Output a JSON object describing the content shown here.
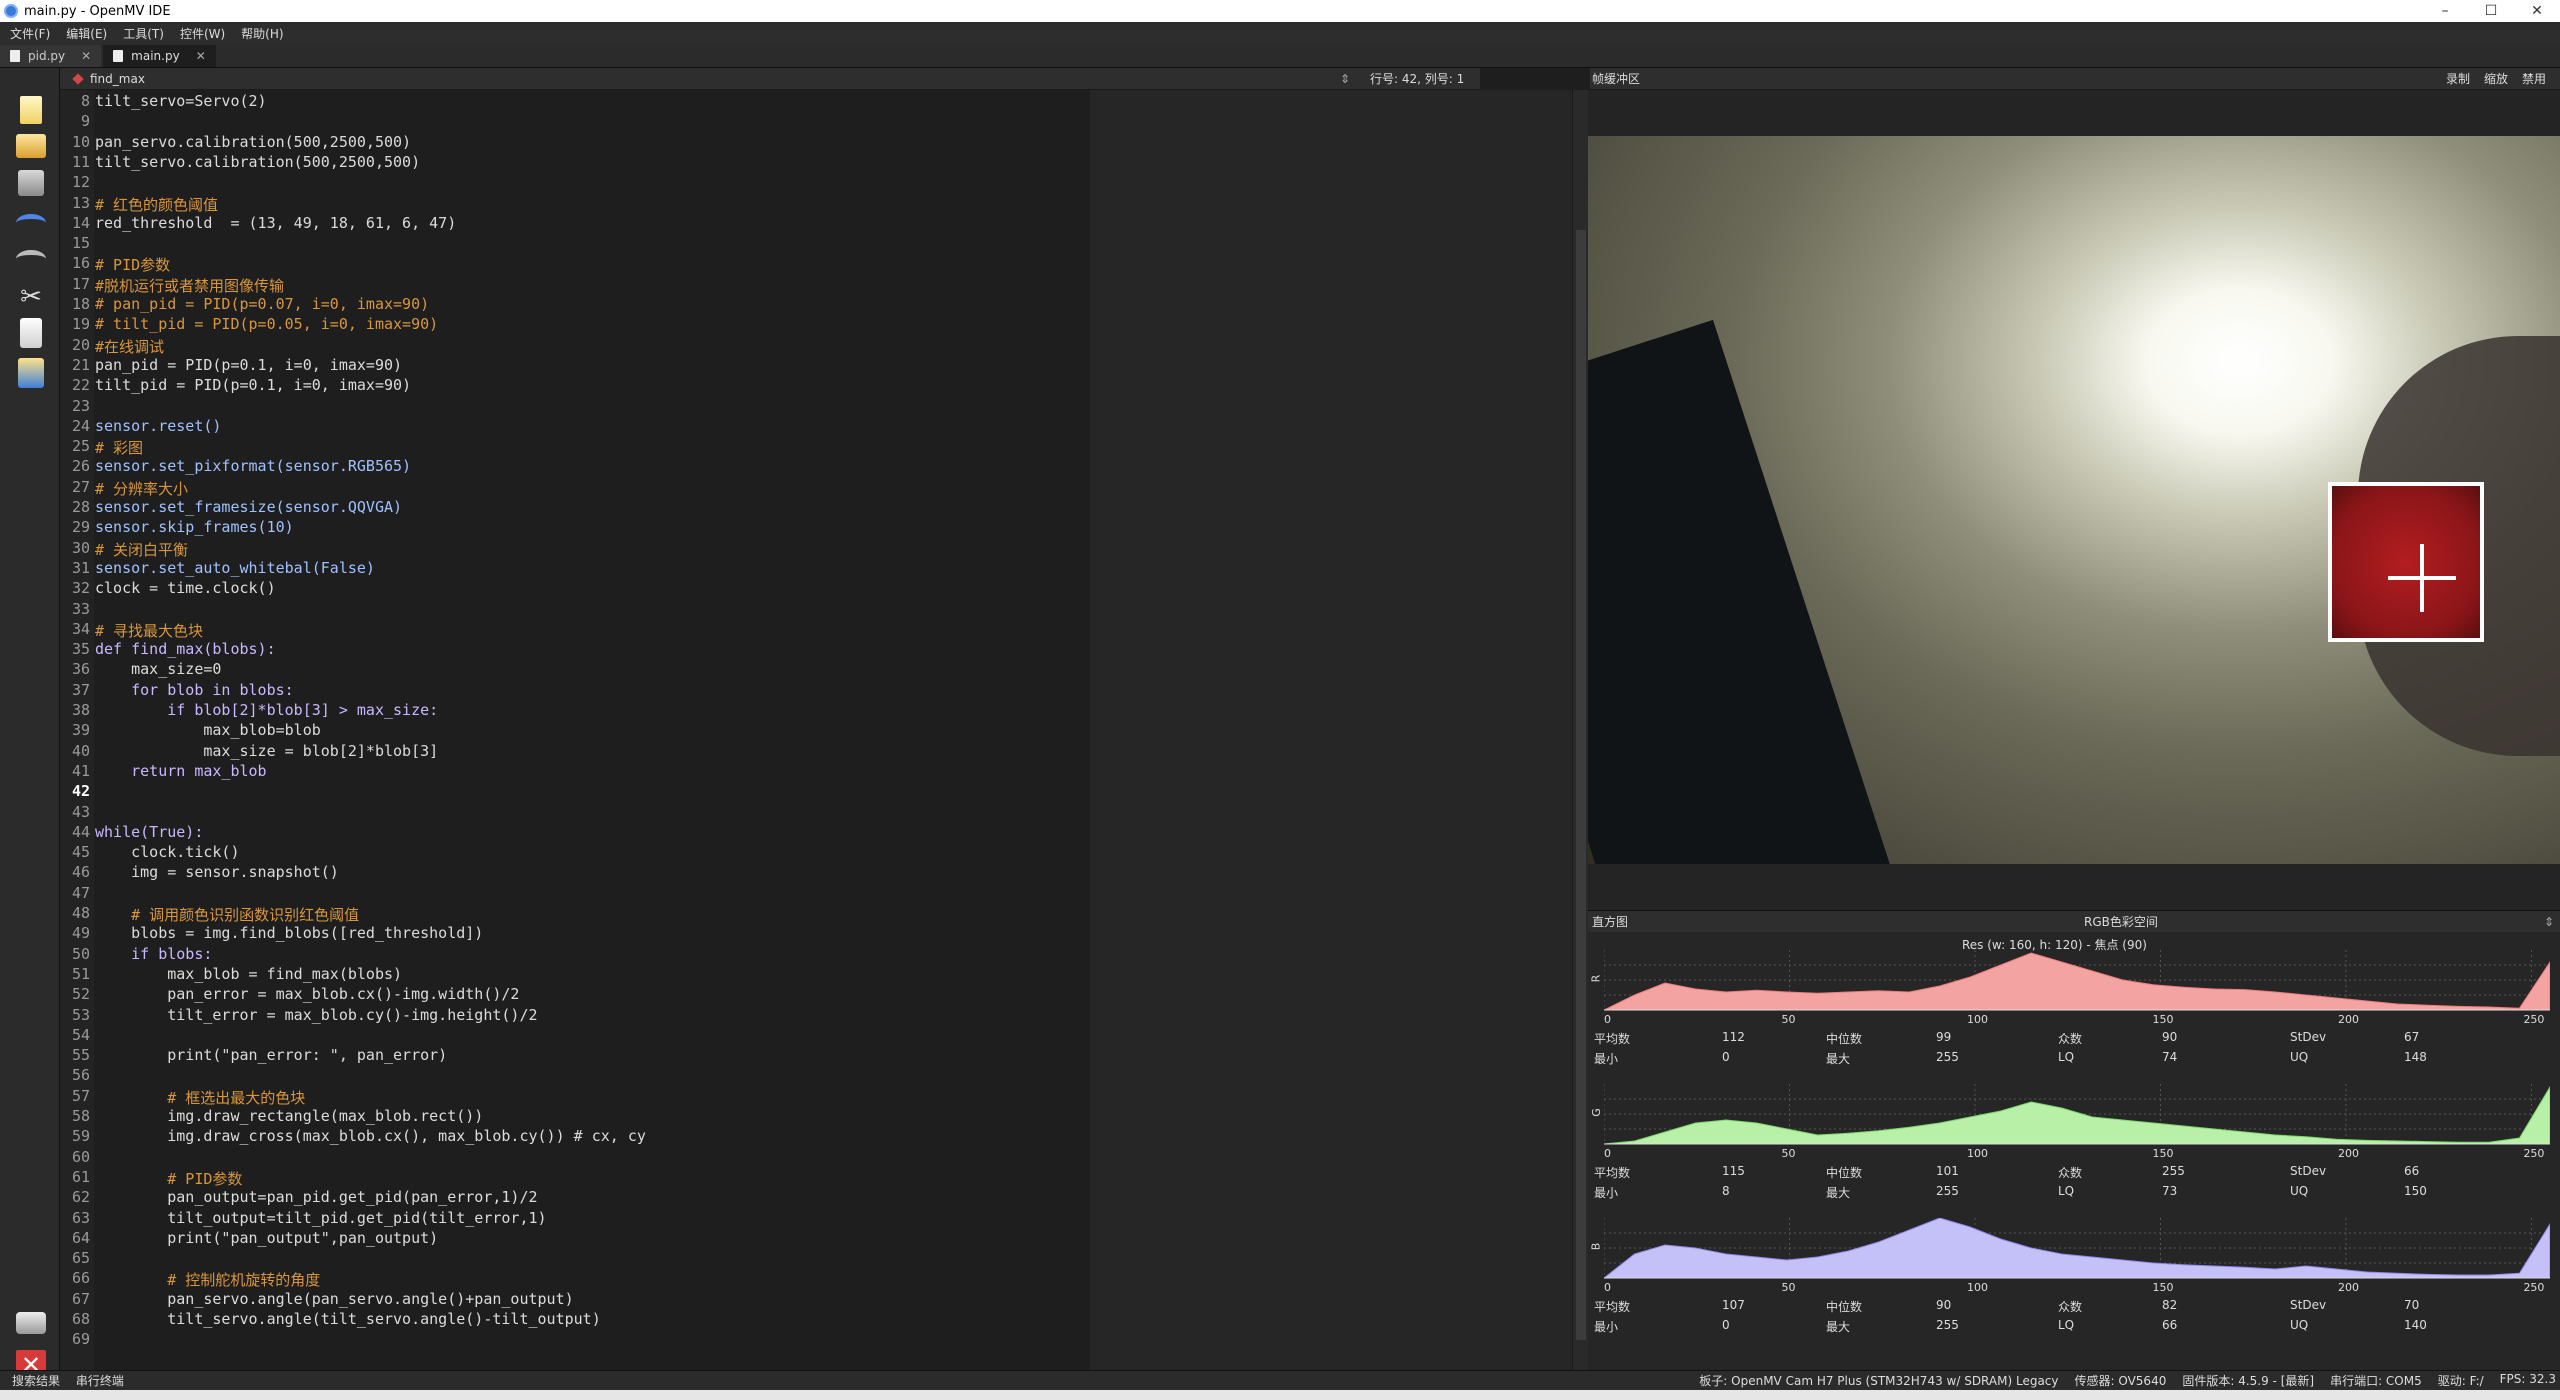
{
  "window": {
    "title": "main.py - OpenMV IDE",
    "controls": [
      "–",
      "☐",
      "✕"
    ]
  },
  "menu": [
    "文件(F)",
    "编辑(E)",
    "工具(T)",
    "控件(W)",
    "帮助(H)"
  ],
  "tabs": [
    {
      "label": "pid.py",
      "close": "✕"
    },
    {
      "label": "main.py",
      "close": "✕"
    }
  ],
  "editor": {
    "function_label": "find_max",
    "updown": "⇕",
    "position": "行号: 42, 列号: 1",
    "current_line": 42,
    "line_numbers": [
      "8",
      "9",
      "10",
      "11",
      "12",
      "13",
      "14",
      "15",
      "16",
      "17",
      "18",
      "19",
      "20",
      "21",
      "22",
      "23",
      "24",
      "25",
      "26",
      "27",
      "28",
      "29",
      "30",
      "31",
      "32",
      "33",
      "34",
      "35",
      "36",
      "37",
      "38",
      "39",
      "40",
      "41",
      "42",
      "43",
      "44",
      "45",
      "46",
      "47",
      "48",
      "49",
      "50",
      "51",
      "52",
      "53",
      "54",
      "55",
      "56",
      "57",
      "58",
      "59",
      "60",
      "61",
      "62",
      "63",
      "64",
      "65",
      "66",
      "67",
      "68",
      "69"
    ],
    "lines": [
      "tilt_servo=Servo(2)",
      "",
      "pan_servo.calibration(500,2500,500)",
      "tilt_servo.calibration(500,2500,500)",
      "",
      "# 红色的颜色阈值",
      "red_threshold  = (13, 49, 18, 61, 6, 47)",
      "",
      "# PID参数",
      "#脱机运行或者禁用图像传输",
      "# pan_pid = PID(p=0.07, i=0, imax=90)",
      "# tilt_pid = PID(p=0.05, i=0, imax=90)",
      "#在线调试",
      "pan_pid = PID(p=0.1, i=0, imax=90)",
      "tilt_pid = PID(p=0.1, i=0, imax=90)",
      "",
      "sensor.reset()",
      "# 彩图",
      "sensor.set_pixformat(sensor.RGB565)",
      "# 分辨率大小",
      "sensor.set_framesize(sensor.QQVGA)",
      "sensor.skip_frames(10)",
      "# 关闭白平衡",
      "sensor.set_auto_whitebal(False)",
      "clock = time.clock()",
      "",
      "# 寻找最大色块",
      "def find_max(blobs):",
      "    max_size=0",
      "    for blob in blobs:",
      "        if blob[2]*blob[3] > max_size:",
      "            max_blob=blob",
      "            max_size = blob[2]*blob[3]",
      "    return max_blob",
      "",
      "",
      "while(True):",
      "    clock.tick()",
      "    img = sensor.snapshot()",
      "",
      "    # 调用颜色识别函数识别红色阈值",
      "    blobs = img.find_blobs([red_threshold])",
      "    if blobs:",
      "        max_blob = find_max(blobs)",
      "        pan_error = max_blob.cx()-img.width()/2",
      "        tilt_error = max_blob.cy()-img.height()/2",
      "",
      "        print(\"pan_error: \", pan_error)",
      "",
      "        # 框选出最大的色块",
      "        img.draw_rectangle(max_blob.rect())",
      "        img.draw_cross(max_blob.cx(), max_blob.cy()) # cx, cy",
      "",
      "        # PID参数",
      "        pan_output=pan_pid.get_pid(pan_error,1)/2",
      "        tilt_output=tilt_pid.get_pid(tilt_error,1)",
      "        print(\"pan_output\",pan_output)",
      "",
      "        # 控制舵机旋转的角度",
      "        pan_servo.angle(pan_servo.angle()+pan_output)",
      "        tilt_servo.angle(tilt_servo.angle()-tilt_output)",
      ""
    ]
  },
  "frame_buffer": {
    "title": "帧缓冲区",
    "buttons": [
      "录制",
      "缩放",
      "禁用"
    ]
  },
  "histogram": {
    "title": "直方图",
    "colorspace": "RGB色彩空间",
    "dropdown": "⇕",
    "resolution": "Res  (w: 160,  h: 120)  - 焦点  (90)",
    "x_ticks": [
      "0",
      "50",
      "100",
      "150",
      "200",
      "250"
    ],
    "stat_labels": {
      "mean": "平均数",
      "median": "中位数",
      "mode": "众数",
      "stdev": "StDev",
      "min": "最小",
      "max": "最大",
      "lq": "LQ",
      "uq": "UQ"
    },
    "channels": [
      {
        "axis": "R",
        "color": "#f4a3a3",
        "line": "#f07a7a",
        "mean": "112",
        "median": "99",
        "mode": "90",
        "stdev": "67",
        "min": "0",
        "max": "255",
        "lq": "74",
        "uq": "148",
        "curve": [
          0,
          0.25,
          0.45,
          0.35,
          0.3,
          0.33,
          0.3,
          0.28,
          0.3,
          0.32,
          0.3,
          0.4,
          0.55,
          0.75,
          0.95,
          0.8,
          0.65,
          0.5,
          0.42,
          0.38,
          0.35,
          0.34,
          0.3,
          0.25,
          0.2,
          0.15,
          0.1,
          0.08,
          0.06,
          0.05,
          0.03,
          0.8
        ]
      },
      {
        "axis": "G",
        "color": "#b8f0a8",
        "line": "#7ad66a",
        "mean": "115",
        "median": "101",
        "mode": "255",
        "stdev": "66",
        "min": "8",
        "max": "255",
        "lq": "73",
        "uq": "150",
        "curve": [
          0,
          0.05,
          0.2,
          0.35,
          0.4,
          0.35,
          0.25,
          0.15,
          0.18,
          0.22,
          0.28,
          0.35,
          0.45,
          0.55,
          0.7,
          0.6,
          0.45,
          0.4,
          0.35,
          0.3,
          0.25,
          0.2,
          0.15,
          0.12,
          0.08,
          0.06,
          0.05,
          0.04,
          0.03,
          0.03,
          0.1,
          0.95
        ]
      },
      {
        "axis": "B",
        "color": "#c4c0f8",
        "line": "#8f86ee",
        "mean": "107",
        "median": "90",
        "mode": "82",
        "stdev": "70",
        "min": "0",
        "max": "255",
        "lq": "66",
        "uq": "140",
        "curve": [
          0,
          0.4,
          0.55,
          0.5,
          0.4,
          0.35,
          0.3,
          0.35,
          0.45,
          0.6,
          0.8,
          1.0,
          0.85,
          0.65,
          0.5,
          0.4,
          0.35,
          0.3,
          0.25,
          0.22,
          0.2,
          0.18,
          0.15,
          0.2,
          0.15,
          0.1,
          0.08,
          0.06,
          0.05,
          0.05,
          0.08,
          0.9
        ]
      }
    ]
  },
  "status": {
    "left": [
      "搜索结果",
      "串行终端"
    ],
    "board": "板子: OpenMV Cam H7 Plus (STM32H743 w/ SDRAM) Legacy",
    "sensor": "传感器: OV5640",
    "firmware": "固件版本: 4.5.9 - [最新]",
    "port": "串行端口: COM5",
    "drive": "驱动: F:/",
    "fps": "FPS: 32.3"
  }
}
